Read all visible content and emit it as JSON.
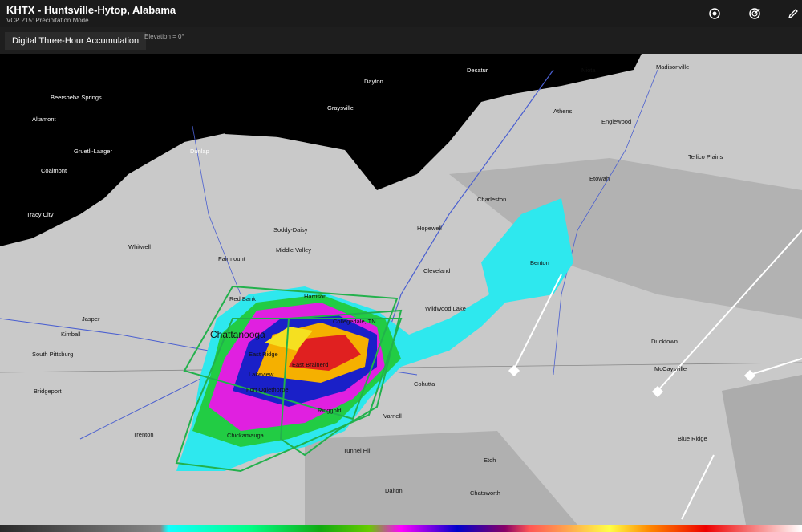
{
  "header": {
    "title": "KHTX - Huntsville-Hytop, Alabama",
    "subtitle": "VCP 215: Precipitation Mode"
  },
  "toolbar": {
    "icons": [
      "target-icon",
      "radar-sweep-icon",
      "pencil-icon"
    ]
  },
  "product": {
    "label": "Digital Three-Hour Accumulation",
    "elevation": "Elevation = 0°"
  },
  "map": {
    "cities": [
      {
        "name": "Dayton"
      },
      {
        "name": "Decatur"
      },
      {
        "name": "Niota"
      },
      {
        "name": "Madisonville"
      },
      {
        "name": "Beersheba Springs"
      },
      {
        "name": "Altamont"
      },
      {
        "name": "Graysville"
      },
      {
        "name": "Athens"
      },
      {
        "name": "Englewood"
      },
      {
        "name": "Gruetli-Laager"
      },
      {
        "name": "Dunlap"
      },
      {
        "name": "Coalmont"
      },
      {
        "name": "Tellico Plains"
      },
      {
        "name": "Etowah"
      },
      {
        "name": "Charleston"
      },
      {
        "name": "Tracy City"
      },
      {
        "name": "Soddy-Daisy"
      },
      {
        "name": "Hopewell"
      },
      {
        "name": "Whitwell"
      },
      {
        "name": "Middle Valley"
      },
      {
        "name": "Fairmount"
      },
      {
        "name": "Benton"
      },
      {
        "name": "Cleveland"
      },
      {
        "name": "Harrison"
      },
      {
        "name": "Red Bank"
      },
      {
        "name": "Wildwood Lake"
      },
      {
        "name": "Jasper"
      },
      {
        "name": "Chattanooga"
      },
      {
        "name": "Collegedale, TN"
      },
      {
        "name": "Kimball"
      },
      {
        "name": "East Ridge"
      },
      {
        "name": "Ducktown"
      },
      {
        "name": "South Pittsburg"
      },
      {
        "name": "Lakeview"
      },
      {
        "name": "East Brainerd"
      },
      {
        "name": "McCaysville"
      },
      {
        "name": "Cohutta"
      },
      {
        "name": "Fort Oglethorpe"
      },
      {
        "name": "Bridgeport"
      },
      {
        "name": "Ringgold"
      },
      {
        "name": "Trenton"
      },
      {
        "name": "Chickamauga"
      },
      {
        "name": "Varnell"
      },
      {
        "name": "Blue Ridge"
      },
      {
        "name": "Tunnel Hill"
      },
      {
        "name": "Etoh"
      },
      {
        "name": "Dalton"
      },
      {
        "name": "Chatsworth"
      }
    ]
  },
  "colors": {
    "background": "#111111",
    "topbar": "#1b1b1b",
    "map_land": "#c8c8c8",
    "outside_range": "#000000",
    "warning_polygon": "#22b14c"
  }
}
